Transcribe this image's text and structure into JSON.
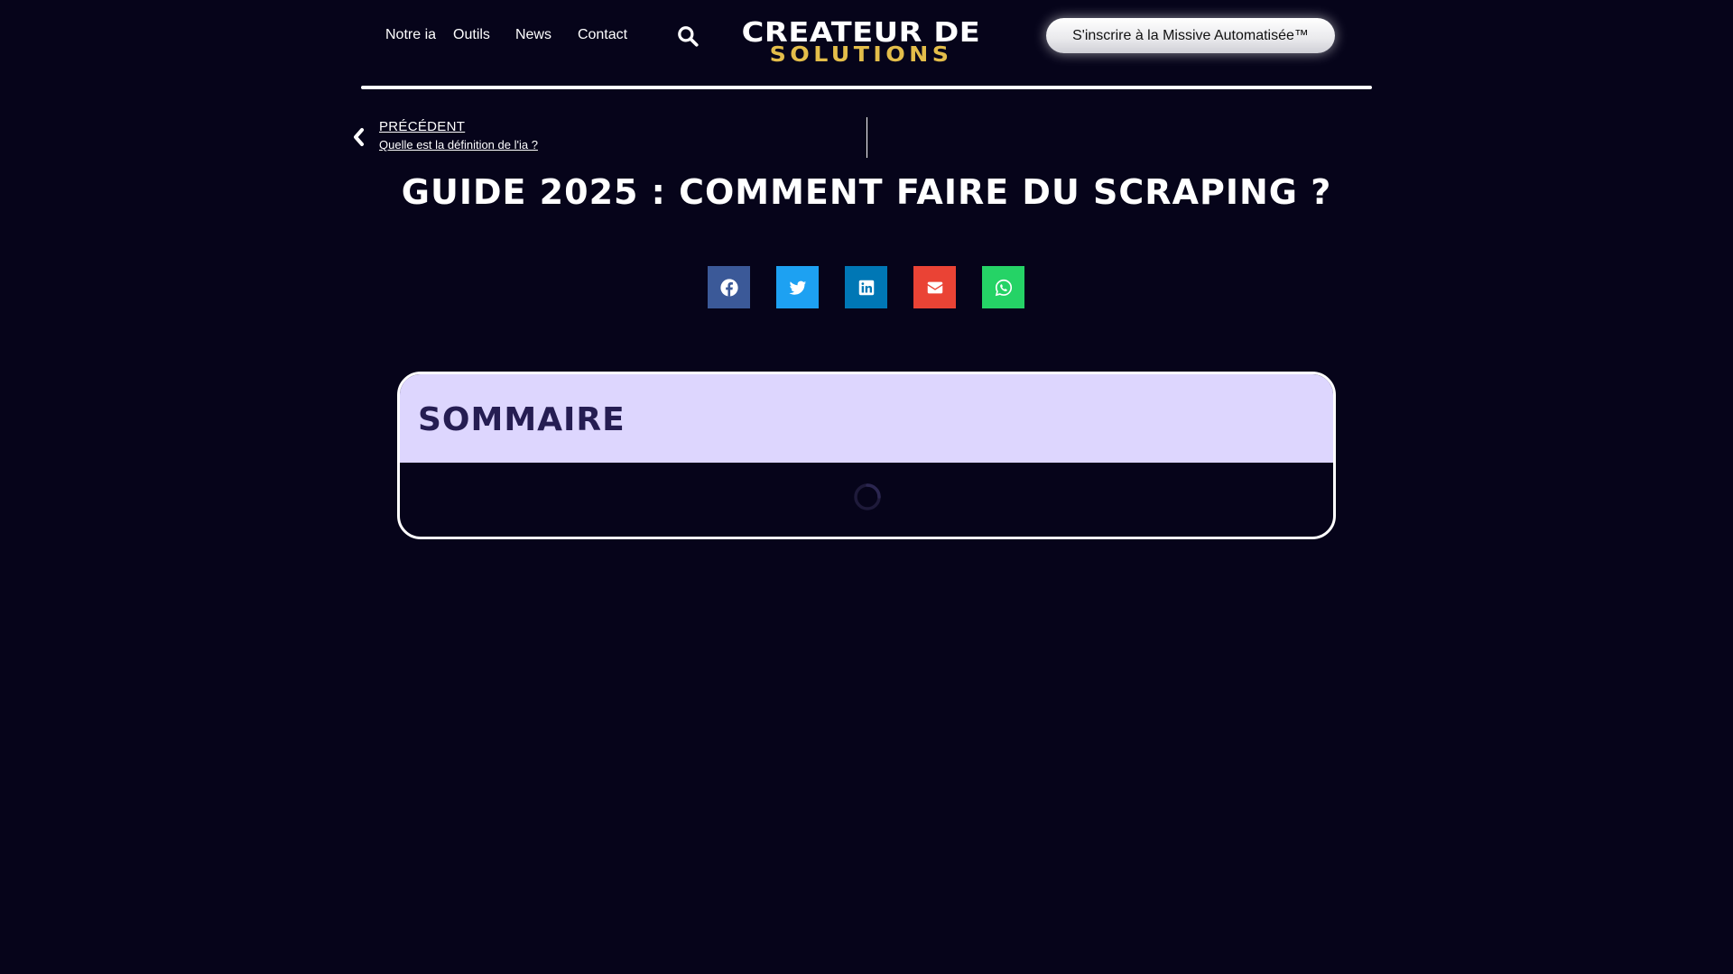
{
  "nav": {
    "items": [
      {
        "label": "Notre ia"
      },
      {
        "label": "Outils"
      },
      {
        "label": "News"
      },
      {
        "label": "Contact"
      }
    ]
  },
  "logo": {
    "line1": "CREATEUR DE",
    "line2": "SOLUTIONS"
  },
  "cta": {
    "label": "S'inscrire à la Missive Automatisée™"
  },
  "post_nav": {
    "prev_label": "PRÉCÉDENT",
    "prev_title": "Quelle est la définition de l'ia ?"
  },
  "article": {
    "title": "GUIDE 2025 : COMMENT FAIRE DU SCRAPING ?"
  },
  "share": {
    "buttons": [
      {
        "icon": "facebook-icon",
        "color": "#3b5998"
      },
      {
        "icon": "twitter-icon",
        "color": "#1da1f2"
      },
      {
        "icon": "linkedin-icon",
        "color": "#0077b5"
      },
      {
        "icon": "envelope-icon",
        "color": "#ea4335"
      },
      {
        "icon": "whatsapp-icon",
        "color": "#25d366"
      }
    ]
  },
  "toc": {
    "title": "SOMMAIRE"
  },
  "colors": {
    "background": "#06041a",
    "logo_gold": "#e3bd4a",
    "toc_header_bg": "#ddd6fe",
    "toc_title": "#251d52"
  }
}
